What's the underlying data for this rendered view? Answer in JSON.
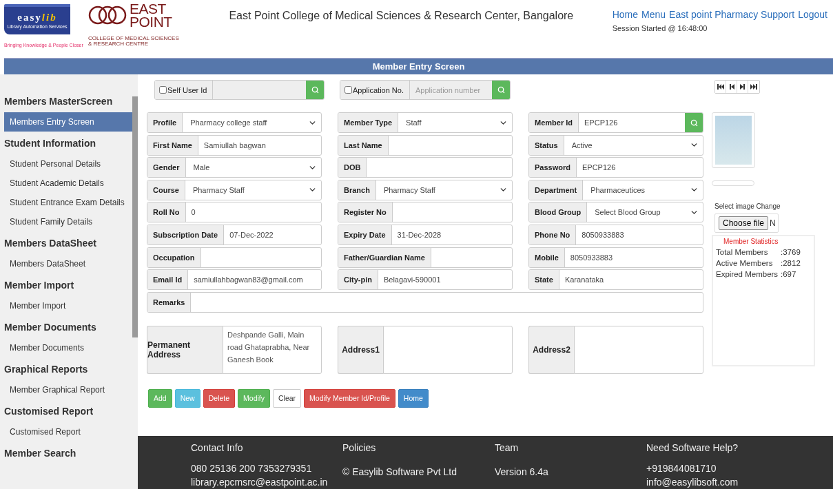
{
  "header": {
    "easylib_logo": {
      "name_part_1": "easy",
      "name_part_2": "lib",
      "subtitle": "Library Automation Services",
      "tagline": "Bringing Knowledge & People Closer"
    },
    "college_logo": {
      "name_line_1": "EAST",
      "name_line_2": "POINT",
      "subtitle_line_1": "COLLEGE OF MEDICAL SCIENCES",
      "subtitle_line_2": "& RESEARCH CENTRE"
    },
    "title": "East Point College of Medical Sciences & Research Center, Bangalore",
    "links": [
      "Home",
      "Menu",
      "East point Pharmacy Support",
      "Logout"
    ],
    "session": "Session Started @ 16:48:00"
  },
  "page_title": "Member Entry Screen",
  "sidebar": {
    "groups": [
      {
        "heading": "Members MasterScreen",
        "items": [
          {
            "label": "Members Entry Screen",
            "selected": true
          }
        ]
      },
      {
        "heading": "Student Information",
        "items": [
          {
            "label": "Student Personal Details",
            "selected": false
          },
          {
            "label": "Student Academic Details",
            "selected": false
          },
          {
            "label": "Student Entrance Exam Details",
            "selected": false
          },
          {
            "label": "Student Family Details",
            "selected": false
          }
        ]
      },
      {
        "heading": "Members DataSheet",
        "items": [
          {
            "label": "Members DataSheet",
            "selected": false
          }
        ]
      },
      {
        "heading": "Member Import",
        "items": [
          {
            "label": "Member Import",
            "selected": false
          }
        ]
      },
      {
        "heading": "Member Documents",
        "items": [
          {
            "label": "Member Documents",
            "selected": false
          }
        ]
      },
      {
        "heading": "Graphical Reports",
        "items": [
          {
            "label": "Member Graphical Report",
            "selected": false
          }
        ]
      },
      {
        "heading": "Customised Report",
        "items": [
          {
            "label": "Customised Report",
            "selected": false
          }
        ]
      },
      {
        "heading": "Member Search"
      }
    ]
  },
  "lookups": [
    {
      "label": "Self User Id",
      "checked": false
    },
    {
      "label": "Application No.",
      "checked": false,
      "placeholder": "Application number"
    }
  ],
  "form": {
    "fields": [
      {
        "label": "Profile",
        "value": "Pharmacy college staff",
        "kind": "select"
      },
      {
        "label": "Member Type",
        "value": "Staff",
        "kind": "select"
      },
      {
        "label": "Member Id",
        "value": "EPCP126",
        "kind": "search"
      },
      {
        "label": "First Name",
        "value": "Samiullah bagwan",
        "kind": "input"
      },
      {
        "label": "Last Name",
        "kind": "input"
      },
      {
        "label": "Status",
        "value": "Active",
        "kind": "select"
      },
      {
        "label": "Gender",
        "value": "Male",
        "kind": "select"
      },
      {
        "label": "DOB",
        "kind": "input"
      },
      {
        "label": "Password",
        "value": "EPCP126",
        "kind": "input"
      },
      {
        "label": "Course",
        "value": "Pharmacy Staff",
        "kind": "select"
      },
      {
        "label": "Branch",
        "value": "Pharmacy Staff",
        "kind": "select"
      },
      {
        "label": "Department",
        "value": "Pharmaceutices",
        "kind": "select"
      },
      {
        "label": "Roll No",
        "value": "0",
        "kind": "input"
      },
      {
        "label": "Register No",
        "kind": "input"
      },
      {
        "label": "Blood Group",
        "value": "Select Blood Group",
        "kind": "select"
      },
      {
        "label": "Subscription Date",
        "value": "07-Dec-2022",
        "kind": "input"
      },
      {
        "label": "Expiry Date",
        "value": "31-Dec-2028",
        "kind": "input"
      },
      {
        "label": "Phone No",
        "value": "8050933883",
        "kind": "input"
      },
      {
        "label": "Occupation",
        "kind": "input"
      },
      {
        "label": "Father/Guardian Name",
        "kind": "input"
      },
      {
        "label": "Mobile",
        "value": "8050933883",
        "kind": "input"
      },
      {
        "label": "Email Id",
        "value": "samiullahbagwan83@gmail.com",
        "kind": "input"
      },
      {
        "label": "City-pin",
        "value": "Belagavi-590001",
        "kind": "input"
      },
      {
        "label": "State",
        "value": "Karanataka",
        "kind": "input"
      }
    ],
    "remarks": {
      "label": "Remarks"
    },
    "addresses": [
      {
        "label": "Permanent Address",
        "value": "Deshpande Galli, Main road Ghataprabha, Near Ganesh Book"
      },
      {
        "label": "Address1"
      },
      {
        "label": "Address2"
      }
    ],
    "buttons": [
      {
        "label": "Add",
        "kind": "success"
      },
      {
        "label": "New",
        "kind": "info"
      },
      {
        "label": "Delete",
        "kind": "danger"
      },
      {
        "label": "Modify",
        "kind": "success"
      },
      {
        "label": "Clear",
        "kind": "default"
      },
      {
        "label": "Modify Member Id/Profile",
        "kind": "danger"
      },
      {
        "label": "Home",
        "kind": "primary"
      }
    ]
  },
  "photo_panel": {
    "select_label": "Select image Change",
    "file_button": "Choose file",
    "file_status": "N",
    "statistics": {
      "title": "Member Statistics",
      "rows": [
        {
          "label": "Total Members",
          "value": ":3769"
        },
        {
          "label": "Active Members",
          "value": ":2812"
        },
        {
          "label": "Expired Members",
          "value": ":697"
        }
      ]
    }
  },
  "footer": {
    "columns": [
      {
        "heading": "Contact Info",
        "lines": [
          "080 25136 200 7353279351",
          "library.epcmsrc@eastpoint.ac.in"
        ]
      },
      {
        "heading": "Policies",
        "lines": [
          "© Easylib Software Pvt Ltd"
        ]
      },
      {
        "heading": "Team",
        "lines": [
          "Version 6.4a"
        ]
      },
      {
        "heading": "Need Software Help?",
        "lines": [
          "+919844081710",
          "info@easylibsoft.com"
        ]
      }
    ]
  }
}
